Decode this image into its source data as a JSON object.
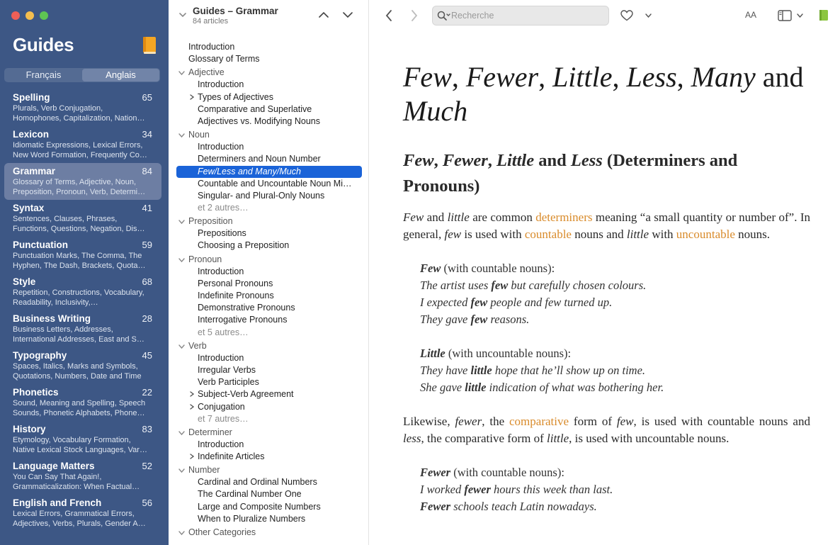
{
  "sidebar": {
    "title": "Guides",
    "languages": [
      "Français",
      "Anglais"
    ],
    "categories": [
      {
        "name": "Spelling",
        "count": "65",
        "desc": "Plurals, Verb Conjugation, Homophones, Capitalization, Nation…"
      },
      {
        "name": "Lexicon",
        "count": "34",
        "desc": "Idiomatic Expressions, Lexical Errors, New Word Formation, Frequently Co…"
      },
      {
        "name": "Grammar",
        "count": "84",
        "desc": "Glossary of Terms, Adjective, Noun, Preposition, Pronoun, Verb, Determi…"
      },
      {
        "name": "Syntax",
        "count": "41",
        "desc": "Sentences, Clauses, Phrases, Functions, Questions, Negation, Dis…"
      },
      {
        "name": "Punctuation",
        "count": "59",
        "desc": "Punctuation Marks, The Comma, The Hyphen, The Dash, Brackets, Quota…"
      },
      {
        "name": "Style",
        "count": "68",
        "desc": "Repetition, Constructions, Vocabulary, Readability, Inclusivity,…"
      },
      {
        "name": "Business Writing",
        "count": "28",
        "desc": "Business Letters, Addresses, International Addresses, East and S…"
      },
      {
        "name": "Typography",
        "count": "45",
        "desc": "Spaces, Italics, Marks and Symbols, Quotations, Numbers, Date and Time"
      },
      {
        "name": "Phonetics",
        "count": "22",
        "desc": "Sound, Meaning and Spelling, Speech Sounds, Phonetic Alphabets, Phone…"
      },
      {
        "name": "History",
        "count": "83",
        "desc": "Etymology, Vocabulary Formation, Native Lexical Stock Languages, Var…"
      },
      {
        "name": "Language Matters",
        "count": "52",
        "desc": "You Can Say That Again!, Grammaticalization: When Factual…"
      },
      {
        "name": "English and French",
        "count": "56",
        "desc": "Lexical Errors, Grammatical Errors, Adjectives, Verbs, Plurals, Gender A…"
      }
    ]
  },
  "toc": {
    "title": "Guides – Grammar",
    "subtitle": "84 articles",
    "items": [
      {
        "label": "Introduction",
        "kind": "lvl0"
      },
      {
        "label": "Glossary of Terms",
        "kind": "lvl0"
      },
      {
        "label": "Adjective",
        "kind": "section"
      },
      {
        "label": "Introduction",
        "kind": "lvl1"
      },
      {
        "label": "Types of Adjectives",
        "kind": "lvl1-collapsed"
      },
      {
        "label": "Comparative and Superlative",
        "kind": "lvl1"
      },
      {
        "label": "Adjectives vs. Modifying Nouns",
        "kind": "lvl1"
      },
      {
        "label": "Noun",
        "kind": "section"
      },
      {
        "label": "Introduction",
        "kind": "lvl1"
      },
      {
        "label": "Determiners and Noun Number",
        "kind": "lvl1"
      },
      {
        "label": "Few/Less and Many/Much",
        "kind": "lvl1-selected"
      },
      {
        "label": "Countable and Uncountable Noun Mi…",
        "kind": "lvl1"
      },
      {
        "label": "Singular- and Plural-Only Nouns",
        "kind": "lvl1"
      },
      {
        "label": "et 2 autres…",
        "kind": "lvl1-more"
      },
      {
        "label": "Preposition",
        "kind": "section"
      },
      {
        "label": "Prepositions",
        "kind": "lvl1"
      },
      {
        "label": "Choosing a Preposition",
        "kind": "lvl1"
      },
      {
        "label": "Pronoun",
        "kind": "section"
      },
      {
        "label": "Introduction",
        "kind": "lvl1"
      },
      {
        "label": "Personal Pronouns",
        "kind": "lvl1"
      },
      {
        "label": "Indefinite Pronouns",
        "kind": "lvl1"
      },
      {
        "label": "Demonstrative Pronouns",
        "kind": "lvl1"
      },
      {
        "label": "Interrogative Pronouns",
        "kind": "lvl1"
      },
      {
        "label": "et 5 autres…",
        "kind": "lvl1-more"
      },
      {
        "label": "Verb",
        "kind": "section"
      },
      {
        "label": "Introduction",
        "kind": "lvl1"
      },
      {
        "label": "Irregular Verbs",
        "kind": "lvl1"
      },
      {
        "label": "Verb Participles",
        "kind": "lvl1"
      },
      {
        "label": "Subject-Verb Agreement",
        "kind": "lvl1-collapsed"
      },
      {
        "label": "Conjugation",
        "kind": "lvl1-collapsed"
      },
      {
        "label": "et 7 autres…",
        "kind": "lvl1-more"
      },
      {
        "label": "Determiner",
        "kind": "section"
      },
      {
        "label": "Introduction",
        "kind": "lvl1"
      },
      {
        "label": "Indefinite Articles",
        "kind": "lvl1-collapsed"
      },
      {
        "label": "Number",
        "kind": "section"
      },
      {
        "label": "Cardinal and Ordinal Numbers",
        "kind": "lvl1"
      },
      {
        "label": "The Cardinal Number One",
        "kind": "lvl1"
      },
      {
        "label": "Large and Composite Numbers",
        "kind": "lvl1"
      },
      {
        "label": "When to Pluralize Numbers",
        "kind": "lvl1"
      },
      {
        "label": "Other Categories",
        "kind": "section"
      }
    ]
  },
  "toolbar": {
    "search_placeholder": "Recherche",
    "font_size_label": "AA"
  },
  "article": {
    "title_parts": [
      "Few",
      ", ",
      "Fewer",
      ", ",
      "Little",
      ", ",
      "Less",
      ", ",
      "Many",
      " and ",
      "Much"
    ],
    "h2_parts": [
      "Few",
      ", ",
      "Fewer",
      ", ",
      "Little",
      " and ",
      "Less",
      " (Determiners and Pronouns)"
    ],
    "p1": {
      "a": "Few",
      "b": " and ",
      "c": "little",
      "d": " are common ",
      "link1": "determiners",
      "e": " meaning “a small quantity or number of”. In general, ",
      "f": "few",
      "g": " is used with ",
      "link2": "countable",
      "h": " nouns and ",
      "i": "little",
      "j": " with ",
      "link3": "uncountable",
      "k": " nouns."
    },
    "ex1": {
      "lead_word": "Few",
      "lead_rest": " (with countable nouns):",
      "l1a": "The artist uses ",
      "l1b": "few",
      "l1c": " but carefully chosen colours.",
      "l2a": "I expected ",
      "l2b": "few",
      "l2c": " people and few turned up.",
      "l3a": "They gave ",
      "l3b": "few",
      "l3c": " reasons."
    },
    "ex2": {
      "lead_word": "Little",
      "lead_rest": " (with uncountable nouns):",
      "l1a": "They have ",
      "l1b": "little",
      "l1c": " hope that he’ll show up on time.",
      "l2a": "She gave ",
      "l2b": "little",
      "l2c": " indication of what was bothering her."
    },
    "p2": {
      "a": "Likewise, ",
      "b": "fewer",
      "c": ", the ",
      "link1": "comparative",
      "d": " form of ",
      "e": "few",
      "f": ", is used with countable nouns and ",
      "g": "less",
      "h": ", the comparative form of ",
      "i": "little",
      "j": ", is used with uncountable nouns."
    },
    "ex3": {
      "lead_word": "Fewer",
      "lead_rest": " (with countable nouns):",
      "l1a": "I worked ",
      "l1b": "fewer",
      "l1c": " hours this week than last.",
      "l2a": "",
      "l2b": "Fewer",
      "l2c": " schools teach Latin nowadays."
    }
  },
  "colors": {
    "sidebar_bg": "#3d5785",
    "sidebar_selected": "#6d7ea3",
    "toc_selected": "#1a63d8",
    "link": "#d98b2b"
  }
}
